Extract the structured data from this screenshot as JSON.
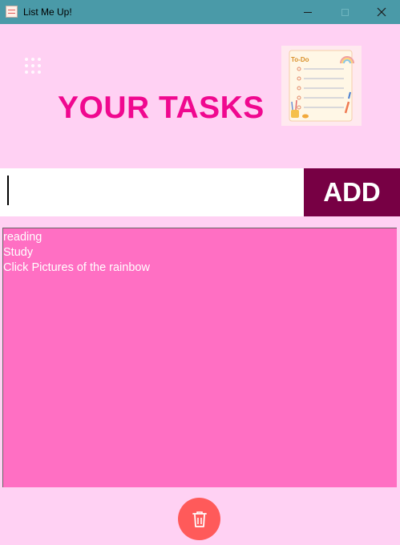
{
  "window": {
    "title": "List Me Up!",
    "icons": {
      "app": "notepad-icon",
      "minimize": "minimize-icon",
      "maximize": "maximize-icon",
      "close": "close-icon"
    }
  },
  "header": {
    "title": "YOUR TASKS",
    "image": "todo-list-illustration",
    "image_caption": "To-Do",
    "menu_icon": "grid-dots-icon"
  },
  "input": {
    "value": "",
    "placeholder": ""
  },
  "add_button": {
    "label": "ADD"
  },
  "tasks": [
    "reading",
    "Study",
    "Click Pictures of the rainbow"
  ],
  "delete_button": {
    "icon": "trash-icon"
  },
  "colors": {
    "background": "#ffd1f3",
    "titlebar": "#4a9aa8",
    "heading": "#f0088f",
    "add_button": "#770044",
    "list_background": "#ff6fc3",
    "delete_button": "#ff5a5a"
  }
}
